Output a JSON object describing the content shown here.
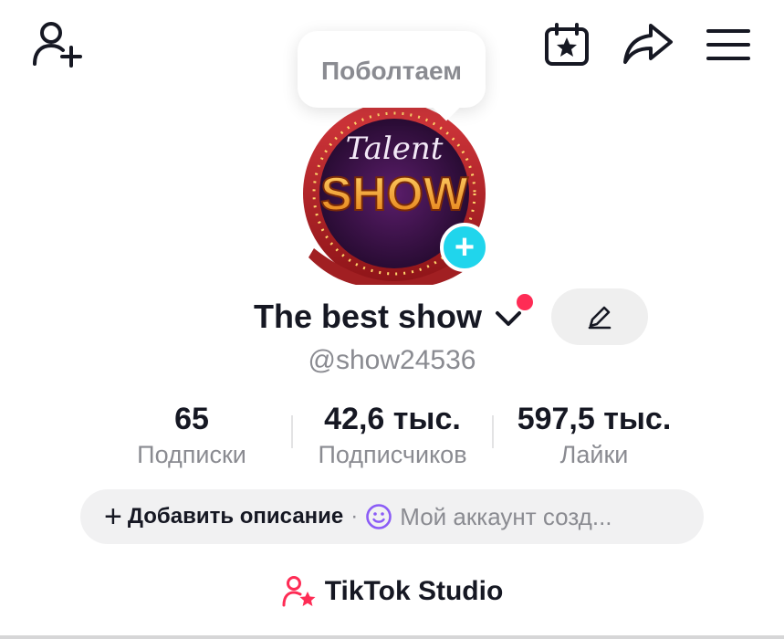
{
  "header": {
    "add_user_icon": "add-user-icon",
    "calendar_icon": "calendar-star-icon",
    "share_icon": "share-arrow-icon",
    "menu_icon": "hamburger-menu-icon"
  },
  "tooltip": {
    "text": "Поболтаем"
  },
  "avatar": {
    "logo_top": "Talent",
    "logo_bottom": "SHOW",
    "add_icon": "plus"
  },
  "profile": {
    "name": "The best show",
    "handle": "@show24536",
    "edit_icon": "pencil-icon"
  },
  "stats": [
    {
      "value": "65",
      "label": "Подписки"
    },
    {
      "value": "42,6 тыс.",
      "label": "Подписчиков"
    },
    {
      "value": "597,5 тыс.",
      "label": "Лайки"
    }
  ],
  "bio": {
    "add_plus": "+",
    "add_label": "Добавить описание",
    "separator": "·",
    "note": "Мой аккаунт созд..."
  },
  "studio": {
    "label": "TikTok Studio"
  },
  "colors": {
    "accent_red": "#fe2c55",
    "avatar_plus": "#20d5ec",
    "smile_purple": "#8b5cf6"
  }
}
